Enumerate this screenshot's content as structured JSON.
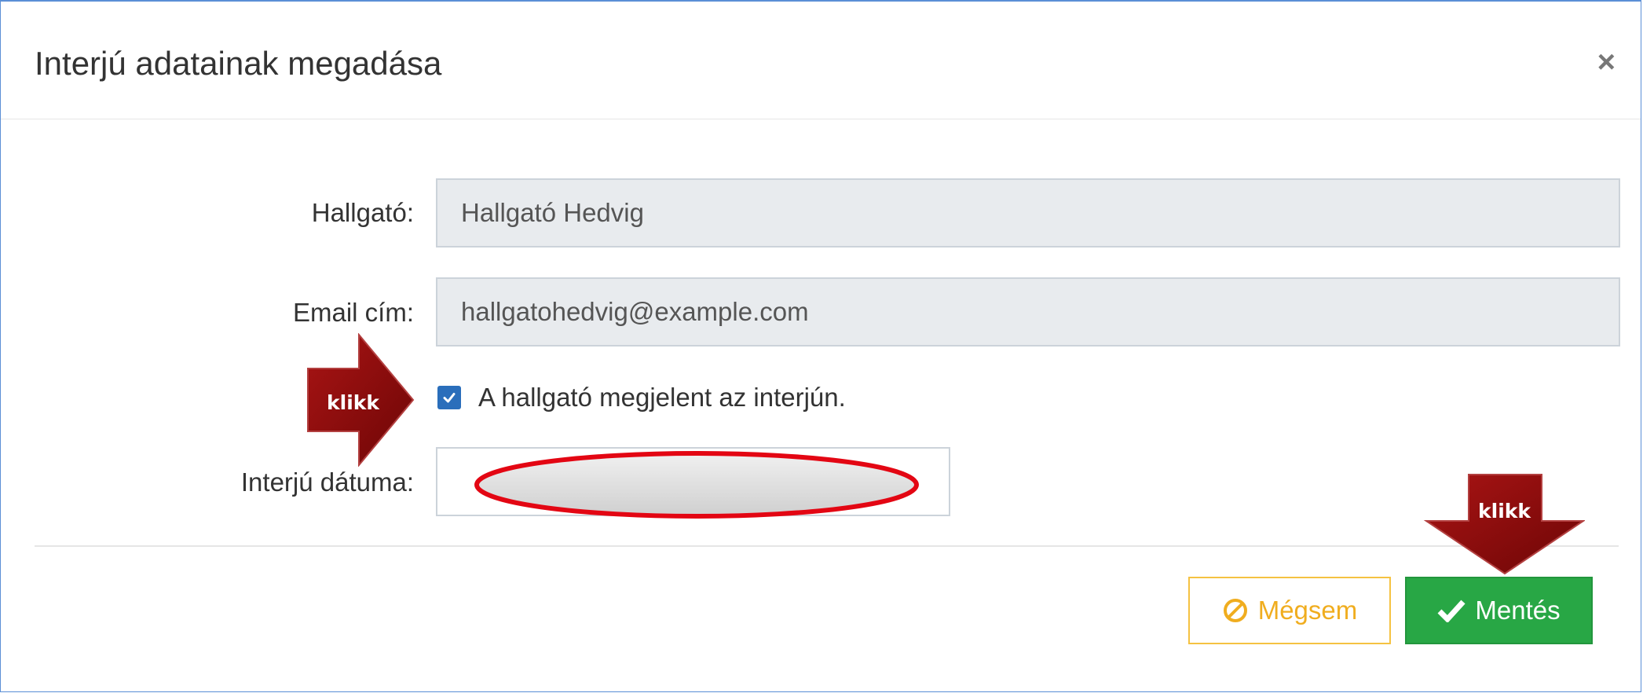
{
  "dialog": {
    "title": "Interjú adatainak megadása",
    "close_symbol": "×"
  },
  "form": {
    "student_label": "Hallgató:",
    "student_value": "Hallgató Hedvig",
    "email_label": "Email cím:",
    "email_value": "hallgatohedvig@example.com",
    "attended_checkbox_label": "A hallgató megjelent az interjún.",
    "attended_checked": true,
    "date_label": "Interjú dátuma:",
    "date_value": ""
  },
  "buttons": {
    "cancel_label": "Mégsem",
    "save_label": "Mentés"
  },
  "annotations": {
    "arrow_checkbox_text": "klikk",
    "arrow_save_text": "klikk"
  },
  "icons": {
    "cancel": "ban-icon",
    "save": "check-icon",
    "close": "close-icon"
  },
  "colors": {
    "accent_blue": "#2a6ebb",
    "save_green": "#28a745",
    "cancel_yellow": "#f0ad1f",
    "annotation_red": "#e30613",
    "arrow_darkred": "#8b0a0a"
  }
}
